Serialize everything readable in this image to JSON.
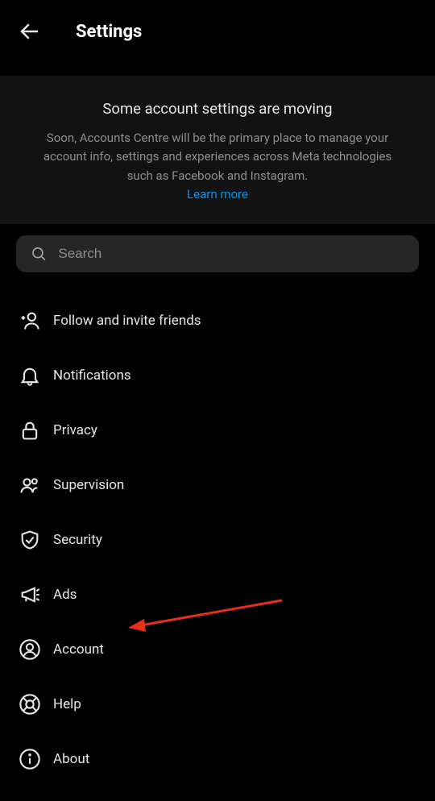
{
  "header": {
    "title": "Settings"
  },
  "notice": {
    "title": "Some account settings are moving",
    "body": "Soon, Accounts Centre will be the primary place to manage your account info, settings and experiences across Meta technologies such as Facebook and Instagram.",
    "link": "Learn more"
  },
  "search": {
    "placeholder": "Search"
  },
  "menu": {
    "items": [
      {
        "label": "Follow and invite friends"
      },
      {
        "label": "Notifications"
      },
      {
        "label": "Privacy"
      },
      {
        "label": "Supervision"
      },
      {
        "label": "Security"
      },
      {
        "label": "Ads"
      },
      {
        "label": "Account"
      },
      {
        "label": "Help"
      },
      {
        "label": "About"
      }
    ]
  },
  "annotation": {
    "target": "Account"
  }
}
